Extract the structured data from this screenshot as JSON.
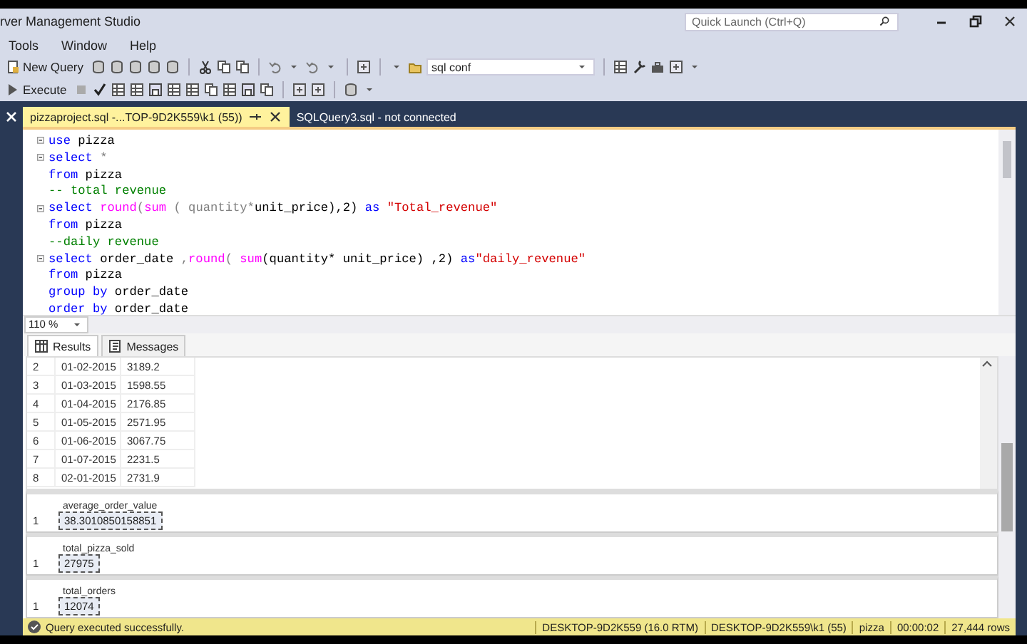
{
  "window": {
    "title": "rver Management Studio",
    "quick_launch": {
      "placeholder": "Quick Launch (Ctrl+Q)"
    }
  },
  "menu": [
    "Tools",
    "Window",
    "Help"
  ],
  "toolbar": {
    "new_query": "New Query",
    "database": "sql conf",
    "execute": "Execute"
  },
  "tabs": [
    {
      "label": "pizzaproject.sql -...TOP-9D2K559\\k1 (55))",
      "selected": true
    },
    {
      "label": "SQLQuery3.sql - not connected",
      "selected": false
    }
  ],
  "editor": {
    "zoom": "110 %",
    "lines": [
      {
        "fold": true,
        "tokens": [
          {
            "text": "use",
            "kind": "kw"
          },
          {
            "text": " pizza",
            "kind": "plain"
          }
        ]
      },
      {
        "fold": true,
        "tokens": [
          {
            "text": "select",
            "kind": "kw"
          },
          {
            "text": " *",
            "kind": "op"
          }
        ]
      },
      {
        "fold": false,
        "tokens": [
          {
            "text": "from",
            "kind": "kw"
          },
          {
            "text": " pizza",
            "kind": "plain"
          }
        ]
      },
      {
        "fold": false,
        "tokens": [
          {
            "text": "-- total revenue",
            "kind": "cmt"
          }
        ]
      },
      {
        "fold": true,
        "tokens": [
          {
            "text": "select ",
            "kind": "kw"
          },
          {
            "text": "round",
            "kind": "fn"
          },
          {
            "text": "(",
            "kind": "op"
          },
          {
            "text": "sum",
            "kind": "fn"
          },
          {
            "text": " ( quantity",
            "kind": "op"
          },
          {
            "text": "*",
            "kind": "op"
          },
          {
            "text": "unit_price),2) ",
            "kind": "plain"
          },
          {
            "text": "as",
            "kind": "kw"
          },
          {
            "text": " \"Total_revenue\"",
            "kind": "str"
          }
        ]
      },
      {
        "fold": false,
        "tokens": [
          {
            "text": "from",
            "kind": "kw"
          },
          {
            "text": " pizza",
            "kind": "plain"
          }
        ]
      },
      {
        "fold": false,
        "tokens": [
          {
            "text": "--daily revenue",
            "kind": "cmt"
          }
        ]
      },
      {
        "fold": true,
        "tokens": [
          {
            "text": "select",
            "kind": "kw"
          },
          {
            "text": " order_date ",
            "kind": "plain"
          },
          {
            "text": ",",
            "kind": "op"
          },
          {
            "text": "round",
            "kind": "fn"
          },
          {
            "text": "( ",
            "kind": "op"
          },
          {
            "text": "sum",
            "kind": "fn"
          },
          {
            "text": "(quantity* unit_price) ,2) ",
            "kind": "plain"
          },
          {
            "text": "as",
            "kind": "kw"
          },
          {
            "text": "\"daily_revenue\"",
            "kind": "str"
          }
        ]
      },
      {
        "fold": false,
        "tokens": [
          {
            "text": "from",
            "kind": "kw"
          },
          {
            "text": " pizza",
            "kind": "plain"
          }
        ]
      },
      {
        "fold": false,
        "tokens": [
          {
            "text": "group by",
            "kind": "kw"
          },
          {
            "text": " order_date",
            "kind": "plain"
          }
        ]
      },
      {
        "fold": false,
        "tokens": [
          {
            "text": "order by",
            "kind": "kw"
          },
          {
            "text": " order_date",
            "kind": "plain"
          }
        ]
      }
    ]
  },
  "results_tabs": [
    {
      "label": "Results",
      "selected": true
    },
    {
      "label": "Messages",
      "selected": false
    }
  ],
  "results_grid": {
    "rows": [
      [
        "2",
        "01-02-2015",
        "3189.2"
      ],
      [
        "3",
        "01-03-2015",
        "1598.55"
      ],
      [
        "4",
        "01-04-2015",
        "2176.85"
      ],
      [
        "5",
        "01-05-2015",
        "2571.95"
      ],
      [
        "6",
        "01-06-2015",
        "3067.75"
      ],
      [
        "7",
        "01-07-2015",
        "2231.5"
      ],
      [
        "8",
        "02-01-2015",
        "2731.9"
      ]
    ]
  },
  "result_sets": [
    {
      "column": "average_order_value",
      "row": "1",
      "value": "38.3010850158851"
    },
    {
      "column": "total_pizza_sold",
      "row": "1",
      "value": "27975"
    },
    {
      "column": "total_orders",
      "row": "1",
      "value": "12074"
    }
  ],
  "status_bar": {
    "message": "Query executed successfully.",
    "segments": [
      "DESKTOP-9D2K559 (16.0 RTM)",
      "DESKTOP-9D2K559\\k1 (55)",
      "pizza",
      "00:00:02",
      "27,444 rows"
    ]
  }
}
